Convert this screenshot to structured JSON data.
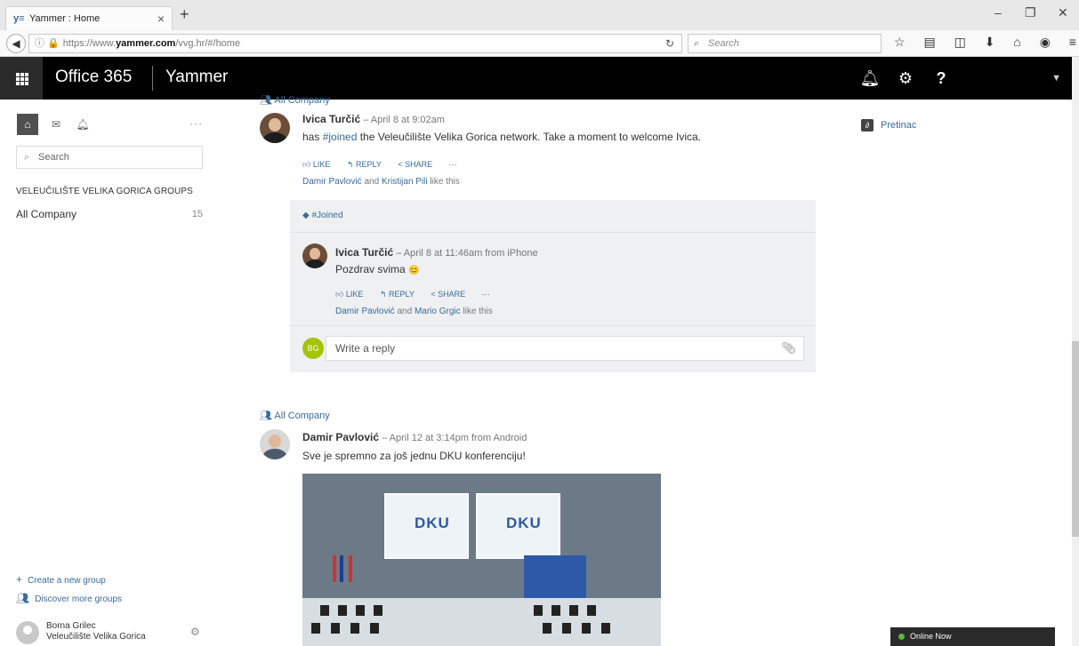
{
  "browser": {
    "tab_title": "Yammer : Home",
    "url_prefix": "https://www.",
    "url_domain": "yammer.com",
    "url_path": "/vvg.hr/#/home",
    "search_placeholder": "Search"
  },
  "o365": {
    "brand": "Office 365",
    "app": "Yammer"
  },
  "rail": {
    "search_placeholder": "Search",
    "groups_title": "VELEUČILIŠTE VELIKA GORICA GROUPS",
    "group_name": "All Company",
    "group_count": "15",
    "create_group": "Create a new group",
    "discover_groups": "Discover more groups",
    "user_name": "Borna Grilec",
    "user_org": "Veleučilište Velika Gorica"
  },
  "post1": {
    "group": "All Company",
    "author": "Ivica Turčić",
    "meta": " – April 8 at 9:02am",
    "text_pre": "has ",
    "hashtag": "#joined",
    "text_post": " the Veleučilište Velika Gorica network. Take a moment to welcome Ivica.",
    "like": "LIKE",
    "reply": "REPLY",
    "share": "SHARE",
    "more": "···",
    "likes_a": "Damir Pavlović",
    "likes_and": " and ",
    "likes_b": "Kristijan Pili",
    "likes_suffix": " like this",
    "tag": "#Joined"
  },
  "reply1": {
    "author": "Ivica Turčić",
    "meta": " – April 8 at 11:46am from iPhone",
    "text": "Pozdrav svima",
    "emoji": "😊",
    "like": "LIKE",
    "reply": "REPLY",
    "share": "SHARE",
    "more": "···",
    "likes_a": "Damir Pavlović",
    "likes_and": " and ",
    "likes_b": "Mario Grgic",
    "likes_suffix": " like this"
  },
  "reply_box": {
    "avatar_initials": "BG",
    "placeholder": "Write a reply"
  },
  "post2": {
    "group": "All Company",
    "author": "Damir Pavlović",
    "meta": " – April 12 at 3:14pm from Android",
    "text": "Sve je spremno za još jednu DKU konferenciju!",
    "screen_logo": "DKU"
  },
  "right": {
    "item": "Pretinac"
  },
  "chat": {
    "status": "Online Now"
  }
}
